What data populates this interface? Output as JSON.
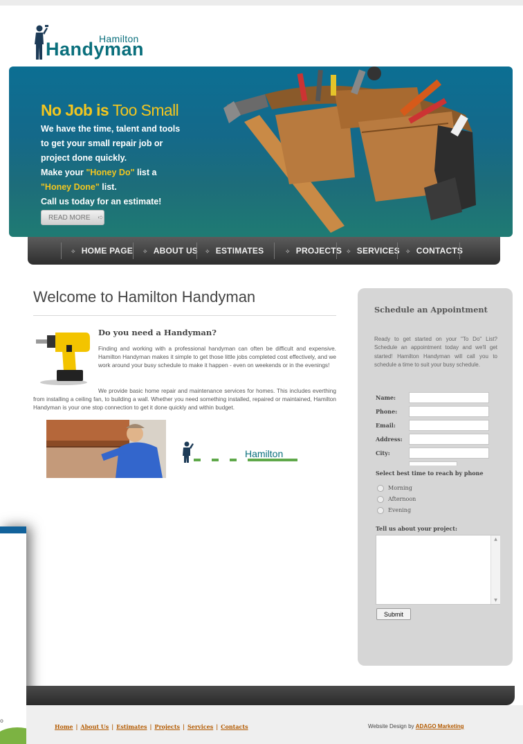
{
  "logo": {
    "small": "Hamilton",
    "big": "Handyman"
  },
  "banner": {
    "headline_bold": "No Job is",
    "headline_light": "Too Small",
    "lines": [
      "We have the time, talent and tools",
      "to get your small repair job or",
      "project done quickly."
    ],
    "line_make": "Make your ",
    "honey_do": "\"Honey Do\"",
    "line_list_a": " list a",
    "honey_done": "\"Honey Done\"",
    "line_list_b": " list.",
    "call": "Call us today for an estimate!",
    "read_more": "READ MORE"
  },
  "nav": {
    "items": [
      "HOME PAGE",
      "ABOUT US",
      "ESTIMATES",
      "PROJECTS",
      "SERVICES",
      "CONTACTS"
    ]
  },
  "main": {
    "title": "Welcome to Hamilton Handyman",
    "question": "Do you need a Handyman?",
    "para1": "Finding and working with a professional handyman can often be difficult and expensive. Hamilton Handyman makes it simple to get those little jobs completed cost effectively, and we work around your busy schedule to make it happen - even on weekends or in the evenings!",
    "para2": "We provide basic home repair and maintenance services for homes. This includes everthing from installing a ceiling fan, to building a wall. Whether you need something installed, repaired or maintained, Hamilton Handyman is your one stop connection to get it done quickly and within budget.",
    "mini_logo": "Hamilton"
  },
  "form": {
    "title": "Schedule an Appointment",
    "intro": "Ready to get started on your \"To Do\" List? Schedule an appointment today and we'll get started! Hamilton Handyman will call you to schedule a time to suit your busy schedule.",
    "labels": [
      "Name:",
      "Phone:",
      "Email:",
      "Address:",
      "City:"
    ],
    "best_time": "Select best time to reach by phone",
    "times": [
      "Morning",
      "Afternoon",
      "Evening"
    ],
    "tell": "Tell us about your project:",
    "submit": "Submit"
  },
  "footer": {
    "links": [
      "Home",
      "About Us",
      "Estimates",
      "Projects",
      "Services",
      "Contacts"
    ],
    "credit_prefix": "Website Design by ",
    "credit_link": "ADAGO Marketing"
  },
  "overlay": {
    "text": "o"
  },
  "colors": {
    "accent": "#f3c61f",
    "brand": "#0a6f7c",
    "link": "#b35a00",
    "nav": "#3a3a3a"
  }
}
